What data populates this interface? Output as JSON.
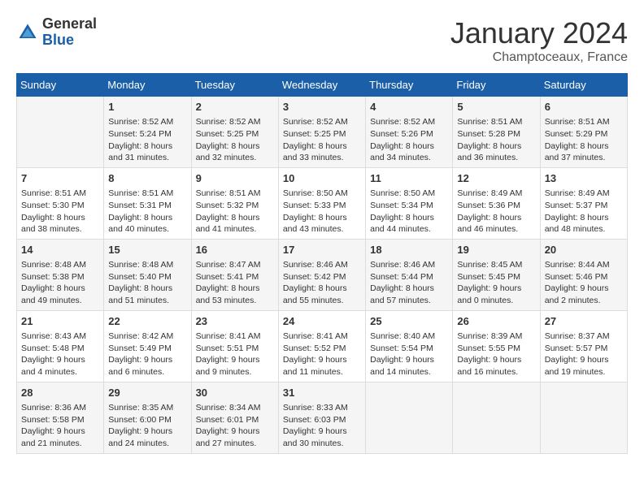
{
  "header": {
    "logo": {
      "general": "General",
      "blue": "Blue"
    },
    "title": "January 2024",
    "location": "Champtoceaux, France"
  },
  "weekdays": [
    "Sunday",
    "Monday",
    "Tuesday",
    "Wednesday",
    "Thursday",
    "Friday",
    "Saturday"
  ],
  "weeks": [
    [
      {
        "day": "",
        "sunrise": "",
        "sunset": "",
        "daylight": ""
      },
      {
        "day": "1",
        "sunrise": "Sunrise: 8:52 AM",
        "sunset": "Sunset: 5:24 PM",
        "daylight": "Daylight: 8 hours and 31 minutes."
      },
      {
        "day": "2",
        "sunrise": "Sunrise: 8:52 AM",
        "sunset": "Sunset: 5:25 PM",
        "daylight": "Daylight: 8 hours and 32 minutes."
      },
      {
        "day": "3",
        "sunrise": "Sunrise: 8:52 AM",
        "sunset": "Sunset: 5:25 PM",
        "daylight": "Daylight: 8 hours and 33 minutes."
      },
      {
        "day": "4",
        "sunrise": "Sunrise: 8:52 AM",
        "sunset": "Sunset: 5:26 PM",
        "daylight": "Daylight: 8 hours and 34 minutes."
      },
      {
        "day": "5",
        "sunrise": "Sunrise: 8:51 AM",
        "sunset": "Sunset: 5:28 PM",
        "daylight": "Daylight: 8 hours and 36 minutes."
      },
      {
        "day": "6",
        "sunrise": "Sunrise: 8:51 AM",
        "sunset": "Sunset: 5:29 PM",
        "daylight": "Daylight: 8 hours and 37 minutes."
      }
    ],
    [
      {
        "day": "7",
        "sunrise": "Sunrise: 8:51 AM",
        "sunset": "Sunset: 5:30 PM",
        "daylight": "Daylight: 8 hours and 38 minutes."
      },
      {
        "day": "8",
        "sunrise": "Sunrise: 8:51 AM",
        "sunset": "Sunset: 5:31 PM",
        "daylight": "Daylight: 8 hours and 40 minutes."
      },
      {
        "day": "9",
        "sunrise": "Sunrise: 8:51 AM",
        "sunset": "Sunset: 5:32 PM",
        "daylight": "Daylight: 8 hours and 41 minutes."
      },
      {
        "day": "10",
        "sunrise": "Sunrise: 8:50 AM",
        "sunset": "Sunset: 5:33 PM",
        "daylight": "Daylight: 8 hours and 43 minutes."
      },
      {
        "day": "11",
        "sunrise": "Sunrise: 8:50 AM",
        "sunset": "Sunset: 5:34 PM",
        "daylight": "Daylight: 8 hours and 44 minutes."
      },
      {
        "day": "12",
        "sunrise": "Sunrise: 8:49 AM",
        "sunset": "Sunset: 5:36 PM",
        "daylight": "Daylight: 8 hours and 46 minutes."
      },
      {
        "day": "13",
        "sunrise": "Sunrise: 8:49 AM",
        "sunset": "Sunset: 5:37 PM",
        "daylight": "Daylight: 8 hours and 48 minutes."
      }
    ],
    [
      {
        "day": "14",
        "sunrise": "Sunrise: 8:48 AM",
        "sunset": "Sunset: 5:38 PM",
        "daylight": "Daylight: 8 hours and 49 minutes."
      },
      {
        "day": "15",
        "sunrise": "Sunrise: 8:48 AM",
        "sunset": "Sunset: 5:40 PM",
        "daylight": "Daylight: 8 hours and 51 minutes."
      },
      {
        "day": "16",
        "sunrise": "Sunrise: 8:47 AM",
        "sunset": "Sunset: 5:41 PM",
        "daylight": "Daylight: 8 hours and 53 minutes."
      },
      {
        "day": "17",
        "sunrise": "Sunrise: 8:46 AM",
        "sunset": "Sunset: 5:42 PM",
        "daylight": "Daylight: 8 hours and 55 minutes."
      },
      {
        "day": "18",
        "sunrise": "Sunrise: 8:46 AM",
        "sunset": "Sunset: 5:44 PM",
        "daylight": "Daylight: 8 hours and 57 minutes."
      },
      {
        "day": "19",
        "sunrise": "Sunrise: 8:45 AM",
        "sunset": "Sunset: 5:45 PM",
        "daylight": "Daylight: 9 hours and 0 minutes."
      },
      {
        "day": "20",
        "sunrise": "Sunrise: 8:44 AM",
        "sunset": "Sunset: 5:46 PM",
        "daylight": "Daylight: 9 hours and 2 minutes."
      }
    ],
    [
      {
        "day": "21",
        "sunrise": "Sunrise: 8:43 AM",
        "sunset": "Sunset: 5:48 PM",
        "daylight": "Daylight: 9 hours and 4 minutes."
      },
      {
        "day": "22",
        "sunrise": "Sunrise: 8:42 AM",
        "sunset": "Sunset: 5:49 PM",
        "daylight": "Daylight: 9 hours and 6 minutes."
      },
      {
        "day": "23",
        "sunrise": "Sunrise: 8:41 AM",
        "sunset": "Sunset: 5:51 PM",
        "daylight": "Daylight: 9 hours and 9 minutes."
      },
      {
        "day": "24",
        "sunrise": "Sunrise: 8:41 AM",
        "sunset": "Sunset: 5:52 PM",
        "daylight": "Daylight: 9 hours and 11 minutes."
      },
      {
        "day": "25",
        "sunrise": "Sunrise: 8:40 AM",
        "sunset": "Sunset: 5:54 PM",
        "daylight": "Daylight: 9 hours and 14 minutes."
      },
      {
        "day": "26",
        "sunrise": "Sunrise: 8:39 AM",
        "sunset": "Sunset: 5:55 PM",
        "daylight": "Daylight: 9 hours and 16 minutes."
      },
      {
        "day": "27",
        "sunrise": "Sunrise: 8:37 AM",
        "sunset": "Sunset: 5:57 PM",
        "daylight": "Daylight: 9 hours and 19 minutes."
      }
    ],
    [
      {
        "day": "28",
        "sunrise": "Sunrise: 8:36 AM",
        "sunset": "Sunset: 5:58 PM",
        "daylight": "Daylight: 9 hours and 21 minutes."
      },
      {
        "day": "29",
        "sunrise": "Sunrise: 8:35 AM",
        "sunset": "Sunset: 6:00 PM",
        "daylight": "Daylight: 9 hours and 24 minutes."
      },
      {
        "day": "30",
        "sunrise": "Sunrise: 8:34 AM",
        "sunset": "Sunset: 6:01 PM",
        "daylight": "Daylight: 9 hours and 27 minutes."
      },
      {
        "day": "31",
        "sunrise": "Sunrise: 8:33 AM",
        "sunset": "Sunset: 6:03 PM",
        "daylight": "Daylight: 9 hours and 30 minutes."
      },
      {
        "day": "",
        "sunrise": "",
        "sunset": "",
        "daylight": ""
      },
      {
        "day": "",
        "sunrise": "",
        "sunset": "",
        "daylight": ""
      },
      {
        "day": "",
        "sunrise": "",
        "sunset": "",
        "daylight": ""
      }
    ]
  ]
}
